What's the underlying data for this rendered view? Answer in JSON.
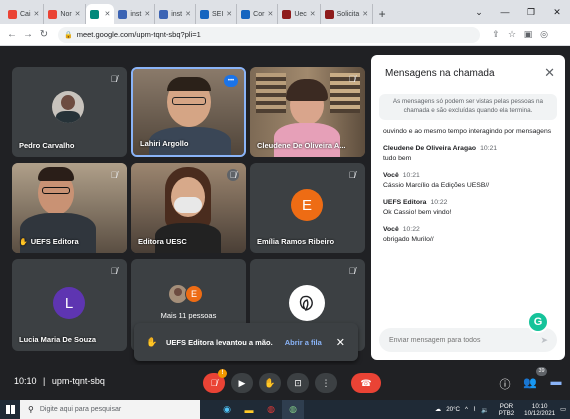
{
  "browser": {
    "tabs": [
      {
        "label": "Cai",
        "color": "#ea4335"
      },
      {
        "label": "Nor",
        "color": "#ea4335"
      },
      {
        "label": "",
        "color": "#00897b"
      },
      {
        "label": "inst",
        "color": "#3c64b4"
      },
      {
        "label": "inst",
        "color": "#3c64b4"
      },
      {
        "label": "SEI",
        "color": "#1565c0"
      },
      {
        "label": "Cor",
        "color": "#1565c0"
      },
      {
        "label": "Uec",
        "color": "#8e1b1b"
      },
      {
        "label": "Solicita",
        "color": "#8e1b1b"
      }
    ],
    "url": "meet.google.com/upm-tqnt-sbq?pli=1"
  },
  "tiles": [
    {
      "name": "Pedro Carvalho"
    },
    {
      "name": "Lahiri Argollo"
    },
    {
      "name": "Cleudene De Oliveira A..."
    },
    {
      "name": "UEFS Editora"
    },
    {
      "name": "Editora UESC"
    },
    {
      "name": "Emília Ramos Ribeiro",
      "initial": "E",
      "color": "#ee6c14"
    },
    {
      "name": "Lucia Maria De Souza",
      "initial": "L",
      "color": "#5e35b1"
    },
    {
      "name": "Mais 11 pessoas",
      "initial": "E",
      "color": "#ee6c14"
    },
    {
      "name": ""
    }
  ],
  "toast": {
    "message": "UEFS Editora levantou a mão.",
    "action": "Abrir a fila"
  },
  "chat": {
    "title": "Mensagens na chamada",
    "notice": "As mensagens só podem ser vistas pelas pessoas na chamada e são excluídas quando ela termina.",
    "clipped_top": "ouvindo e ao mesmo tempo interagindo por mensagens",
    "messages": [
      {
        "sender": "Cleudene De Oliveira Aragao",
        "time": "10:21",
        "text": "tudo bem"
      },
      {
        "sender": "Você",
        "time": "10:21",
        "text": "Cássio Marcílio da Edições UESB//"
      },
      {
        "sender": "UEFS Editora",
        "time": "10:22",
        "text": "Ok Cassio! bem vindo!"
      },
      {
        "sender": "Você",
        "time": "10:22",
        "text": "obrigado Murilo//"
      }
    ],
    "input_placeholder": "Enviar mensagem para todos"
  },
  "controls": {
    "time": "10:10",
    "meeting_code": "upm-tqnt-sbq",
    "people_count": "39"
  },
  "taskbar": {
    "search_placeholder": "Digite aqui para pesquisar",
    "temperature": "20°C",
    "language": "POR",
    "language_sub": "PTB2",
    "clock_time": "10:10",
    "clock_date": "10/12/2021"
  }
}
